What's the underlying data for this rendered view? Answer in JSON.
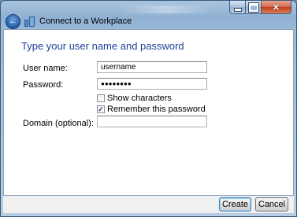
{
  "window": {
    "title": "Connect to a Workplace"
  },
  "page": {
    "heading": "Type your user name and password"
  },
  "form": {
    "username_label": "User name:",
    "username_value": "username",
    "password_label": "Password:",
    "password_value": "●●●●●●●●",
    "show_characters_label": "Show characters",
    "show_characters_checked": false,
    "remember_label": "Remember this password",
    "remember_checked": true,
    "checkmark": "✓",
    "domain_label": "Domain (optional):",
    "domain_value": ""
  },
  "buttons": {
    "create": "Create",
    "cancel": "Cancel"
  },
  "icons": {
    "back": "back-arrow-icon",
    "app": "connect-workplace-icon",
    "close": "close-icon",
    "minimize": "minimize-icon",
    "maximize": "maximize-icon"
  }
}
